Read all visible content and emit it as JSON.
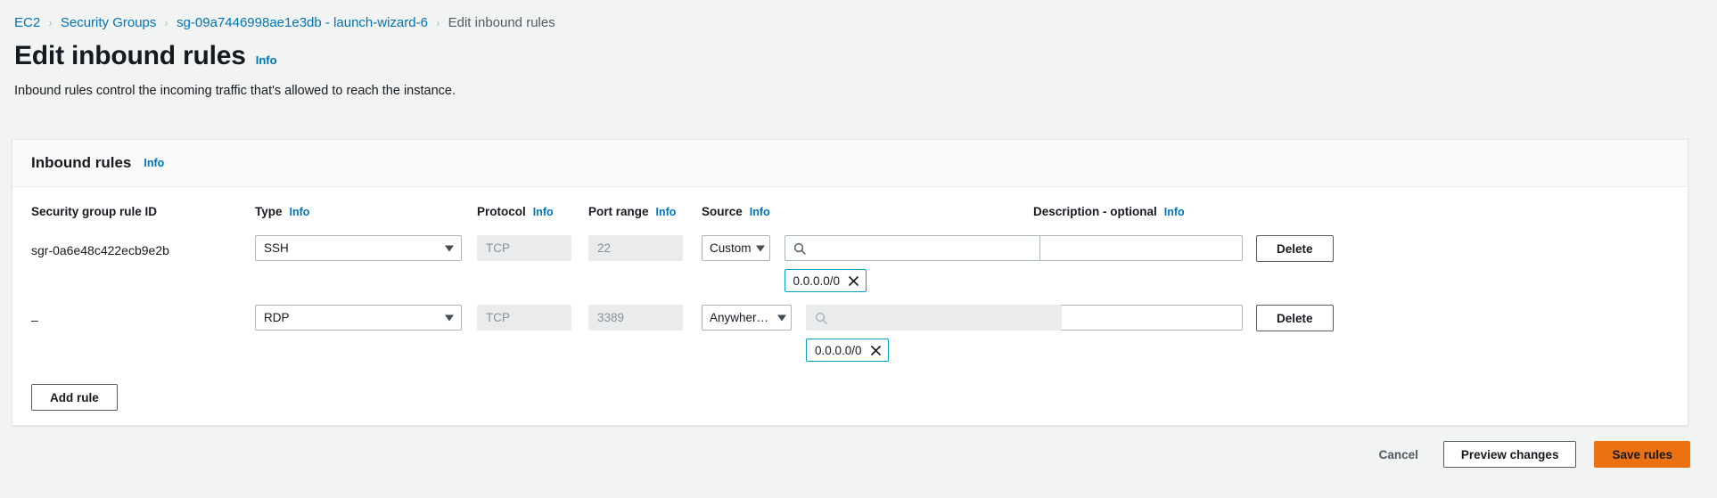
{
  "breadcrumb": {
    "items": [
      {
        "label": "EC2",
        "current": false
      },
      {
        "label": "Security Groups",
        "current": false
      },
      {
        "label": "sg-09a7446998ae1e3db - launch-wizard-6",
        "current": false
      },
      {
        "label": "Edit inbound rules",
        "current": true
      }
    ],
    "separator": "›"
  },
  "header": {
    "title": "Edit inbound rules",
    "info_label": "Info",
    "description": "Inbound rules control the incoming traffic that's allowed to reach the instance."
  },
  "panel": {
    "title": "Inbound rules",
    "info_label": "Info",
    "columns": [
      {
        "label": "Security group rule ID",
        "info": false
      },
      {
        "label": "Type",
        "info": true
      },
      {
        "label": "Protocol",
        "info": true
      },
      {
        "label": "Port range",
        "info": true
      },
      {
        "label": "Source",
        "info": true
      },
      {
        "label": "Description - optional",
        "info": true
      }
    ],
    "rows": [
      {
        "rule_id": "sgr-0a6e48c422ecb9e2b",
        "type": "SSH",
        "protocol": "TCP",
        "port_range": "22",
        "source": "Custom",
        "source_search_value": "",
        "source_search_disabled": false,
        "token": "0.0.0.0/0",
        "description": "",
        "delete_label": "Delete"
      },
      {
        "rule_id": "–",
        "type": "RDP",
        "protocol": "TCP",
        "port_range": "3389",
        "source": "Anywhere-IP…",
        "source_search_value": "",
        "source_search_disabled": true,
        "token": "0.0.0.0/0",
        "description": "",
        "delete_label": "Delete"
      }
    ],
    "add_rule_label": "Add rule"
  },
  "footer": {
    "cancel_label": "Cancel",
    "preview_label": "Preview changes",
    "save_label": "Save rules"
  },
  "colors": {
    "primary_orange": "#ec7211",
    "link_blue": "#0073bb",
    "token_border": "#00a1c9",
    "page_bg": "#f2f3f3"
  }
}
